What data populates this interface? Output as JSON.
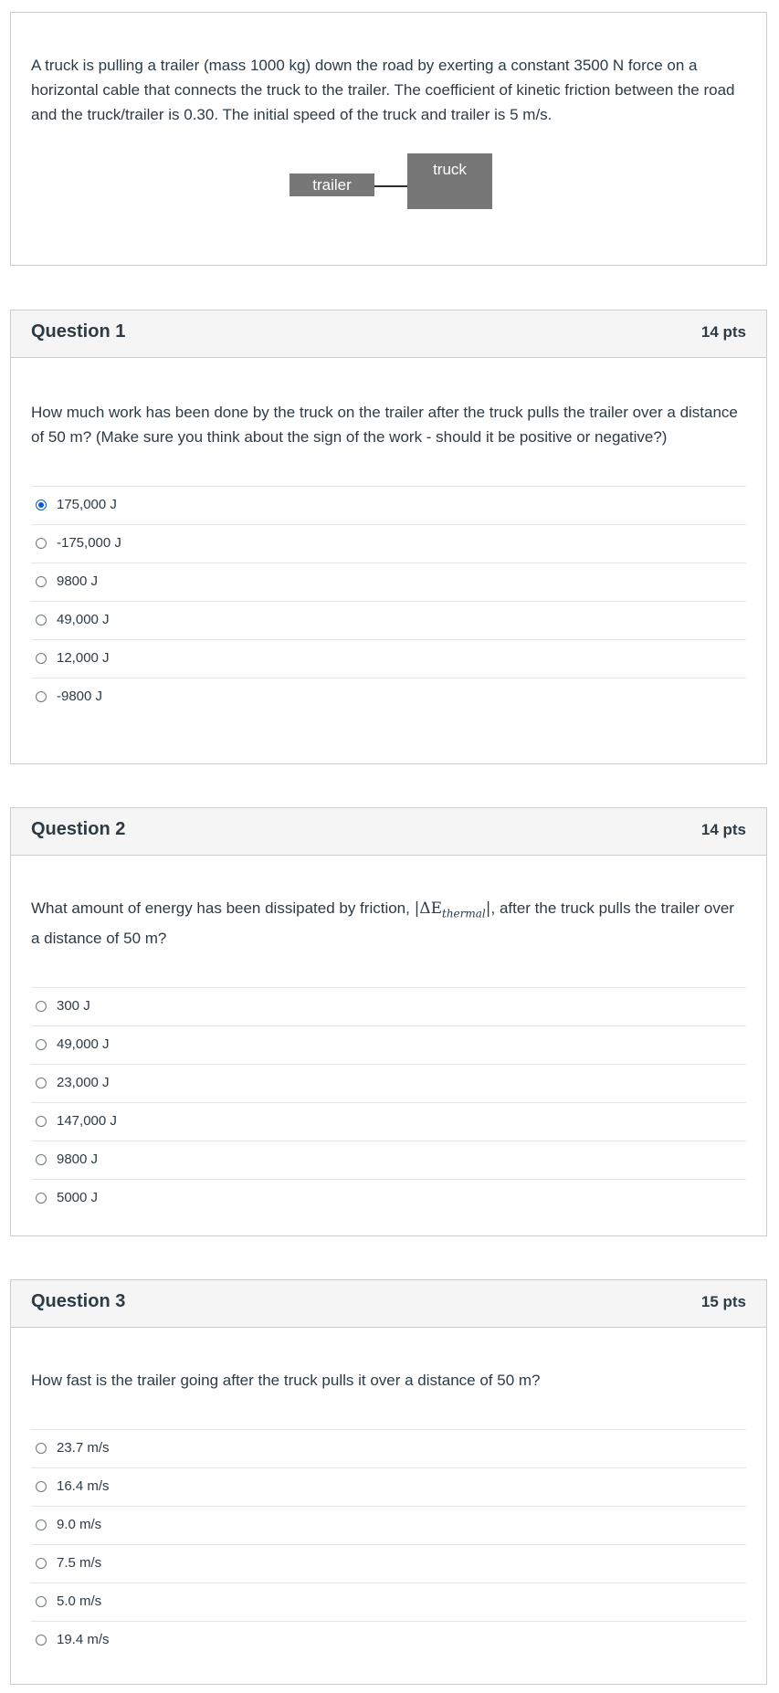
{
  "intro": {
    "text": "A truck is pulling a trailer (mass 1000 kg) down the road by exerting a constant 3500 N force on a horizontal cable that connects the truck to the trailer. The coefficient of kinetic friction between the road and the truck/trailer is 0.30. The initial speed of the truck and trailer is 5 m/s.",
    "diagram": {
      "trailer_label": "trailer",
      "truck_label": "truck"
    }
  },
  "questions": [
    {
      "title": "Question 1",
      "points": "14 pts",
      "text": "How much work has been done by the truck on the trailer after the truck pulls the trailer over a distance of 50 m? (Make sure you think about the sign of the work - should it be positive or negative?)",
      "answers": [
        "175,000 J",
        "-175,000 J",
        "9800 J",
        "49,000 J",
        "12,000 J",
        "-9800 J"
      ],
      "selected_answer": "175,000 J"
    },
    {
      "title": "Question 2",
      "points": "14 pts",
      "text_before": "What amount of energy has been dissipated by friction, ",
      "math": {
        "prefix": "|ΔE",
        "subscript": "thermal",
        "suffix": "|"
      },
      "text_after": ", after the truck pulls the trailer over a distance of 50 m?",
      "answers": [
        "300 J",
        "49,000 J",
        "23,000 J",
        "147,000 J",
        "9800 J",
        "5000 J"
      ],
      "selected_answer": null
    },
    {
      "title": "Question 3",
      "points": "15 pts",
      "text": "How fast is the trailer going after the truck pulls it over a distance of 50 m?",
      "answers": [
        "23.7 m/s",
        "16.4 m/s",
        "9.0 m/s",
        "7.5 m/s",
        "5.0 m/s",
        "19.4 m/s"
      ],
      "selected_answer": null
    }
  ],
  "colors": {
    "accent": "#0b5cd5",
    "border": "#c7cdd1",
    "header_bg": "#f5f5f5",
    "diagram_box": "#777777"
  }
}
